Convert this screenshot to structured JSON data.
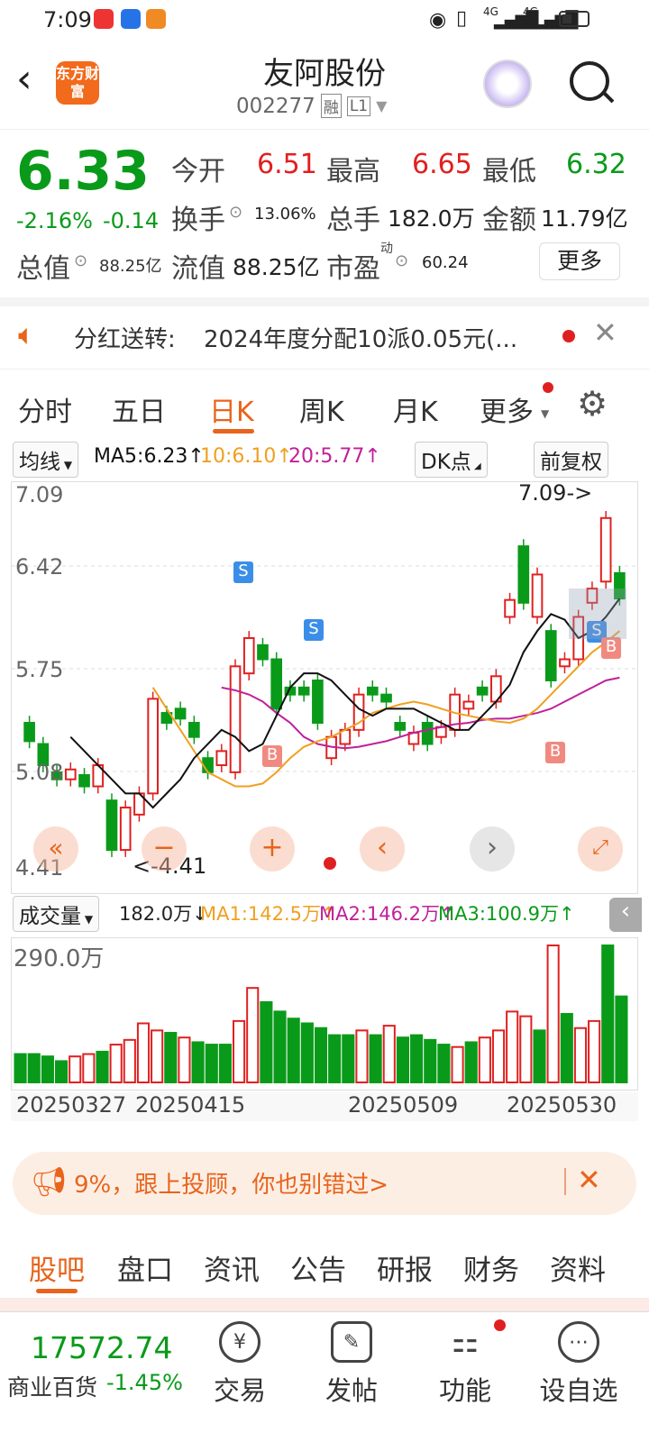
{
  "status": {
    "time": "7:09",
    "net1": "4G",
    "net2": "4G"
  },
  "header": {
    "title": "友阿股份",
    "code": "002277",
    "badge1": "融",
    "badge2": "L1",
    "logo_text": "东方财富"
  },
  "quote": {
    "price": "6.33",
    "change_pct": "-2.16%",
    "change": "-0.14",
    "open_label": "今开",
    "open": "6.51",
    "high_label": "最高",
    "high": "6.65",
    "low_label": "最低",
    "low": "6.32",
    "turnover_label": "换手",
    "turnover": "13.06%",
    "vol_label": "总手",
    "vol": "182.0万",
    "amount_label": "金额",
    "amount": "11.79亿",
    "mcap_label": "总值",
    "mcap": "88.25亿",
    "float_label": "流值",
    "float": "88.25亿",
    "pe_label": "市盈",
    "pe_sup": "动",
    "pe": "60.24",
    "more": "更多"
  },
  "notice": {
    "label": "分红送转:",
    "text": "2024年度分配10派0.05元(..."
  },
  "tabs": [
    "分时",
    "五日",
    "日K",
    "周K",
    "月K",
    "更多"
  ],
  "toolbar": {
    "ma_select": "均线",
    "ma5": "MA5:6.23↑",
    "ma10": "10:6.10↑",
    "ma20": "20:5.77↑",
    "dk": "DK点",
    "adjust": "前复权"
  },
  "chart": {
    "y_ticks": [
      "7.09",
      "6.42",
      "5.75",
      "5.08",
      "4.41"
    ],
    "max_label": "7.09->",
    "min_label": "<-4.41",
    "s_label": "S",
    "b_label": "B"
  },
  "volume": {
    "select": "成交量",
    "current": "182.0万↓",
    "ma1": "MA1:142.5万↑",
    "ma2": "MA2:146.2万↑",
    "ma3": "MA3:100.9万↑",
    "max": "290.0万"
  },
  "dates": [
    "20250327",
    "20250415",
    "20250509",
    "20250530"
  ],
  "ad": {
    "text": "9%，跟上投顾，你也别错过>"
  },
  "bottom_tabs": [
    "股吧",
    "盘口",
    "资讯",
    "公告",
    "研报",
    "财务",
    "资料"
  ],
  "bottombar": {
    "index_value": "17572.74",
    "index_name": "商业百货",
    "index_change": "-1.45%",
    "items": [
      "交易",
      "发帖",
      "功能",
      "设自选"
    ]
  },
  "colors": {
    "up": "#e02020",
    "down": "#0a9a1a",
    "accent": "#e8641c",
    "ma5": "#111111",
    "ma10": "#f0a020",
    "ma20": "#c0209a"
  },
  "chart_data": {
    "type": "candlestick",
    "candles": [
      [
        5.45,
        5.32
      ],
      [
        5.3,
        5.15
      ],
      [
        5.1,
        5.05
      ],
      [
        5.05,
        5.12
      ],
      [
        5.08,
        5.0
      ],
      [
        5.0,
        5.15
      ],
      [
        4.9,
        4.55
      ],
      [
        4.55,
        4.85
      ],
      [
        4.8,
        4.95
      ],
      [
        4.95,
        5.62
      ],
      [
        5.52,
        5.45
      ],
      [
        5.55,
        5.48
      ],
      [
        5.45,
        5.35
      ],
      [
        5.2,
        5.1
      ],
      [
        5.15,
        5.25
      ],
      [
        5.1,
        5.85
      ],
      [
        5.8,
        6.05
      ],
      [
        6.0,
        5.9
      ],
      [
        5.9,
        5.55
      ],
      [
        5.7,
        5.65
      ],
      [
        5.7,
        5.65
      ],
      [
        5.75,
        5.45
      ],
      [
        5.2,
        5.35
      ],
      [
        5.3,
        5.4
      ],
      [
        5.4,
        5.65
      ],
      [
        5.7,
        5.65
      ],
      [
        5.65,
        5.6
      ],
      [
        5.45,
        5.4
      ],
      [
        5.3,
        5.38
      ],
      [
        5.45,
        5.3
      ],
      [
        5.35,
        5.42
      ],
      [
        5.4,
        5.65
      ],
      [
        5.55,
        5.6
      ],
      [
        5.7,
        5.65
      ],
      [
        5.6,
        5.78
      ],
      [
        6.2,
        6.32
      ],
      [
        6.7,
        6.3
      ],
      [
        6.2,
        6.5
      ],
      [
        6.1,
        5.75
      ],
      [
        5.85,
        5.9
      ],
      [
        5.9,
        6.2
      ],
      [
        6.3,
        6.4
      ],
      [
        6.45,
        6.9
      ],
      [
        6.51,
        6.33
      ]
    ],
    "ma5": [
      5.35,
      5.25,
      5.15,
      5.05,
      4.95,
      4.95,
      4.85,
      4.95,
      5.05,
      5.2,
      5.3,
      5.4,
      5.35,
      5.25,
      5.3,
      5.5,
      5.7,
      5.8,
      5.8,
      5.75,
      5.65,
      5.55,
      5.5,
      5.55,
      5.55,
      5.55,
      5.5,
      5.45,
      5.4,
      5.4,
      5.5,
      5.6,
      5.72,
      5.95,
      6.1,
      6.22,
      6.18,
      6.05,
      6.1,
      6.2,
      6.33
    ],
    "ma10": [
      5.7,
      5.55,
      5.4,
      5.25,
      5.1,
      5.05,
      5.0,
      5.0,
      5.02,
      5.1,
      5.2,
      5.28,
      5.32,
      5.35,
      5.4,
      5.45,
      5.52,
      5.55,
      5.58,
      5.6,
      5.58,
      5.55,
      5.52,
      5.5,
      5.48,
      5.46,
      5.45,
      5.48,
      5.55,
      5.65,
      5.75,
      5.85,
      5.95,
      6.02,
      6.1
    ],
    "ma20": [
      5.7,
      5.68,
      5.65,
      5.6,
      5.52,
      5.45,
      5.35,
      5.3,
      5.28,
      5.27,
      5.28,
      5.3,
      5.32,
      5.35,
      5.38,
      5.4,
      5.42,
      5.44,
      5.45,
      5.47,
      5.48,
      5.48,
      5.5,
      5.52,
      5.55,
      5.6,
      5.65,
      5.7,
      5.75,
      5.77
    ],
    "volumes": [
      60,
      60,
      55,
      45,
      55,
      60,
      65,
      80,
      90,
      125,
      110,
      105,
      95,
      85,
      80,
      80,
      130,
      200,
      170,
      150,
      135,
      125,
      115,
      100,
      100,
      110,
      100,
      120,
      95,
      100,
      90,
      80,
      75,
      85,
      95,
      110,
      150,
      140,
      110,
      290,
      145,
      115,
      130,
      290,
      182
    ],
    "vol_up": [
      false,
      false,
      false,
      false,
      true,
      true,
      false,
      true,
      true,
      true,
      true,
      false,
      true,
      false,
      false,
      false,
      true,
      true,
      false,
      false,
      false,
      false,
      false,
      false,
      false,
      true,
      false,
      true,
      false,
      false,
      false,
      false,
      true,
      false,
      true,
      true,
      true,
      true,
      false,
      true,
      false,
      true,
      true,
      false,
      false
    ]
  }
}
